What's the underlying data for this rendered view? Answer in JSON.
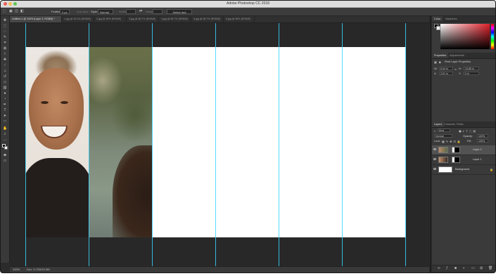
{
  "window": {
    "title": "Adobe Photoshop CC 2018"
  },
  "options_bar": {
    "feather_label": "Feather:",
    "feather_value": "0 px",
    "anti_alias_label": "Anti-alias",
    "style_label": "Style:",
    "style_value": "Normal",
    "width_label": "Width:",
    "height_label": "Height:",
    "select_mask_button": "Select and Mask..."
  },
  "document_tabs": [
    {
      "label": "Untitled-1 @ 100% (Layer 2, RGB/8) *"
    },
    {
      "label": "1.jpg @ 33.3% (RGB/8)"
    },
    {
      "label": "2.jpg @ 50% (RGB/8)"
    },
    {
      "label": "3.jpg @ 66.7% (RGB/8)"
    },
    {
      "label": "4.jpg @ 66.7% (RGB/8)"
    },
    {
      "label": "5.jpg @ 66.7% (RGB/8)"
    },
    {
      "label": "6.jpg @ 50% (RGB/8)"
    }
  ],
  "status_bar": {
    "zoom": "100%",
    "doc_info": "Doc: 5.72M/22.8M"
  },
  "panels": {
    "color_tabs": [
      "Color",
      "Swatches"
    ],
    "properties_tabs": [
      "Properties",
      "Adjustments"
    ],
    "properties_title": "Pixel Layer Properties",
    "props": {
      "w_label": "W:",
      "w_value": "6.04 in",
      "h_label": "H:",
      "h_value": "13.89 in",
      "x_label": "X:",
      "x_value": "3.01 in",
      "y_label": "Y:",
      "y_value": "0 in"
    },
    "layers_tabs": [
      "Layers",
      "Channels",
      "Paths"
    ],
    "kind_label": "Kind",
    "blend_mode": "Normal",
    "opacity_label": "Opacity:",
    "opacity_value": "100%",
    "lock_label": "Lock:",
    "fill_label": "Fill:",
    "fill_value": "100%",
    "layers": [
      {
        "name": "Layer 2"
      },
      {
        "name": "Layer 1"
      },
      {
        "name": "Background"
      }
    ]
  },
  "tools": [
    "move",
    "marquee",
    "lasso",
    "quick-select",
    "crop",
    "frame",
    "eyedropper",
    "healing",
    "brush",
    "clone-stamp",
    "history-brush",
    "eraser",
    "gradient",
    "blur",
    "dodge",
    "pen",
    "type",
    "path-select",
    "rectangle",
    "hand",
    "zoom",
    "more",
    "colors",
    "quick-mask",
    "screen-mode"
  ],
  "colors": {
    "accent_guides": "#39d3ff",
    "panel_bg": "#3a3a3a",
    "canvas_bg": "#282828"
  }
}
